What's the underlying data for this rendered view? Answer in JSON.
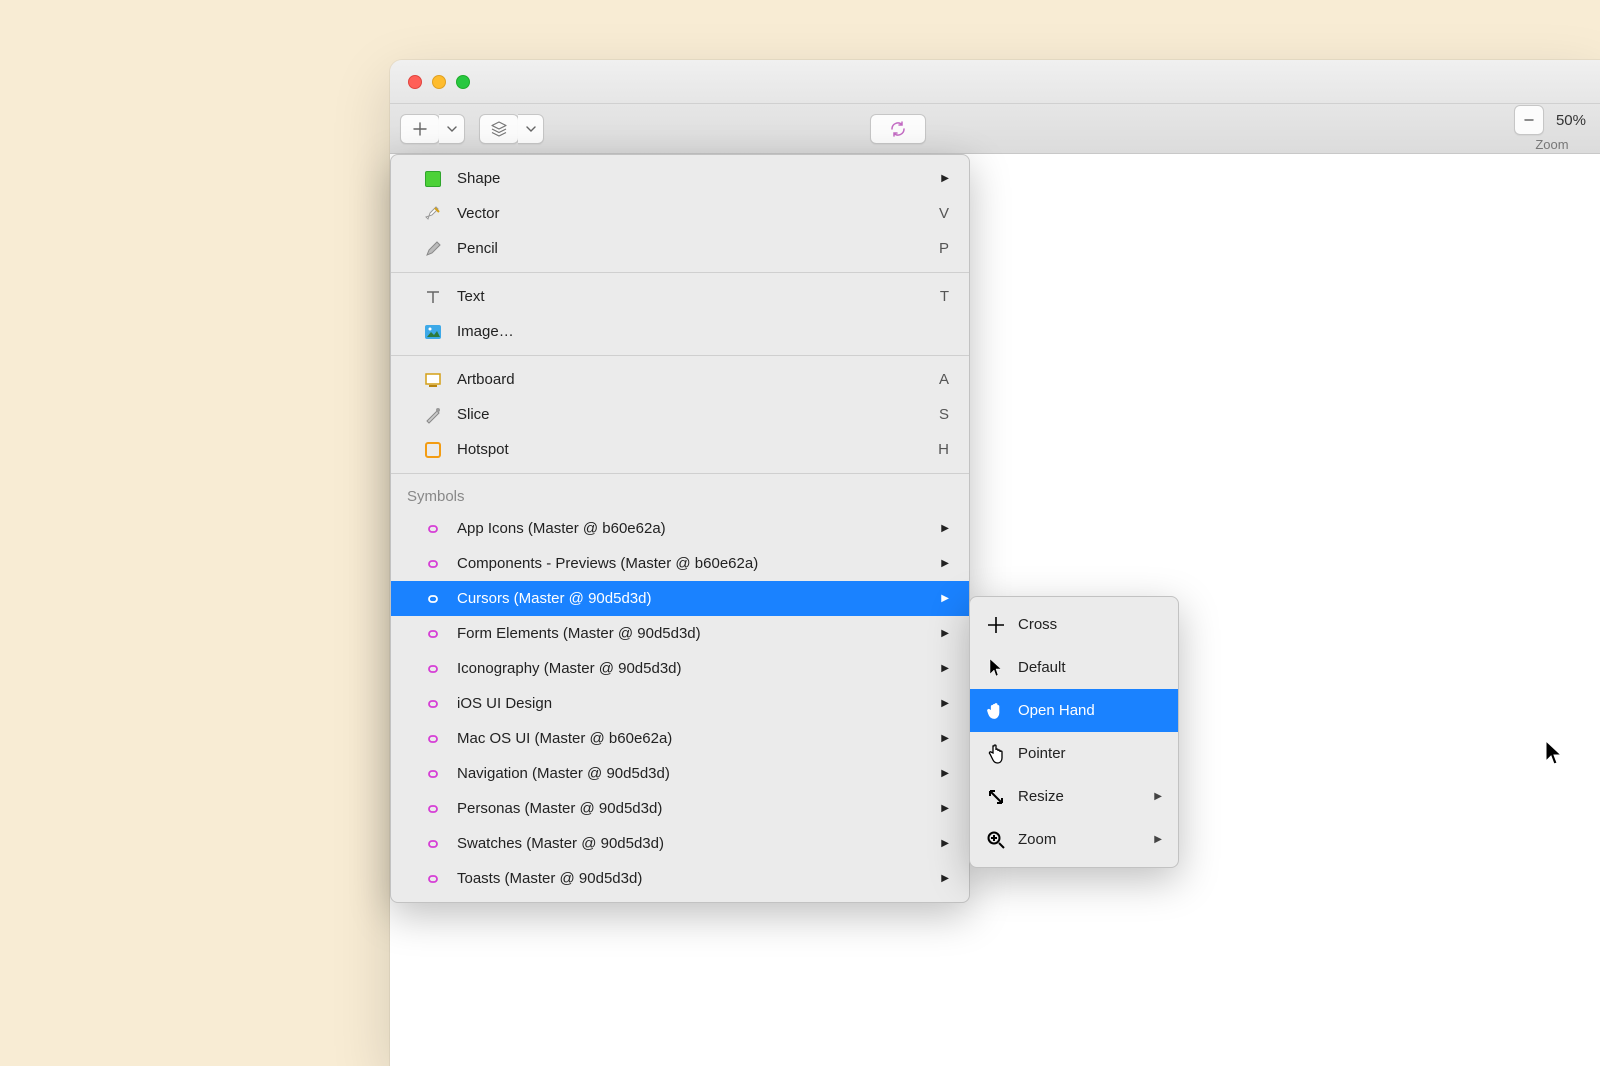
{
  "toolbar": {
    "zoom_value": "50%",
    "zoom_label": "Zoom"
  },
  "insert_menu": {
    "groups": [
      [
        {
          "label": "Shape",
          "icon": "shape",
          "has_sub": true
        },
        {
          "label": "Vector",
          "icon": "pen",
          "shortcut": "V"
        },
        {
          "label": "Pencil",
          "icon": "pencil",
          "shortcut": "P"
        }
      ],
      [
        {
          "label": "Text",
          "icon": "text",
          "shortcut": "T"
        },
        {
          "label": "Image…",
          "icon": "image"
        }
      ],
      [
        {
          "label": "Artboard",
          "icon": "artboard",
          "shortcut": "A"
        },
        {
          "label": "Slice",
          "icon": "slice",
          "shortcut": "S"
        },
        {
          "label": "Hotspot",
          "icon": "hotspot",
          "shortcut": "H"
        }
      ]
    ],
    "symbols_header": "Symbols",
    "symbols": [
      {
        "label": "App Icons (Master @ b60e62a)"
      },
      {
        "label": "Components - Previews (Master @ b60e62a)"
      },
      {
        "label": "Cursors (Master @ 90d5d3d)",
        "selected": true
      },
      {
        "label": "Form Elements (Master @ 90d5d3d)"
      },
      {
        "label": "Iconography (Master @ 90d5d3d)"
      },
      {
        "label": "iOS UI Design"
      },
      {
        "label": "Mac OS UI (Master @ b60e62a)"
      },
      {
        "label": "Navigation (Master @ 90d5d3d)"
      },
      {
        "label": "Personas (Master @ 90d5d3d)"
      },
      {
        "label": "Swatches (Master @ 90d5d3d)"
      },
      {
        "label": "Toasts (Master @ 90d5d3d)"
      }
    ]
  },
  "submenu": {
    "items": [
      {
        "label": "Cross",
        "icon": "cross"
      },
      {
        "label": "Default",
        "icon": "default"
      },
      {
        "label": "Open Hand",
        "icon": "open-hand",
        "selected": true
      },
      {
        "label": "Pointer",
        "icon": "pointer"
      },
      {
        "label": "Resize",
        "icon": "resize",
        "has_sub": true
      },
      {
        "label": "Zoom",
        "icon": "zoom",
        "has_sub": true
      }
    ]
  }
}
